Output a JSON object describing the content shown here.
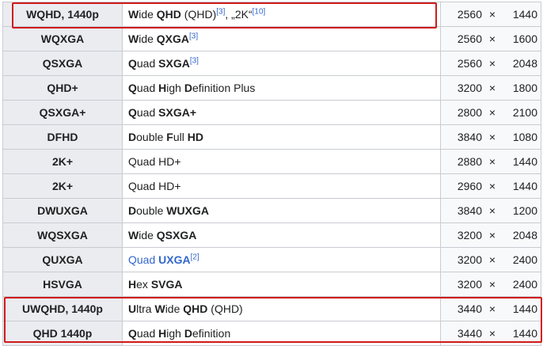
{
  "rows": [
    {
      "name": "WQHD, 1440p",
      "desc": [
        [
          "W",
          true
        ],
        [
          "ide ",
          false
        ],
        [
          "QHD",
          true
        ],
        [
          " (QHD)",
          false
        ]
      ],
      "sup1": "[3]",
      "extra": ", „2K“",
      "sup2": "[10]",
      "w": "2560",
      "h": "1440"
    },
    {
      "name": "WQXGA",
      "desc": [
        [
          "W",
          true
        ],
        [
          "ide ",
          false
        ],
        [
          "QXGA",
          true
        ]
      ],
      "sup1": "[3]",
      "w": "2560",
      "h": "1600"
    },
    {
      "name": "QSXGA",
      "desc": [
        [
          "Q",
          true
        ],
        [
          "uad ",
          false
        ],
        [
          "SXGA",
          true
        ]
      ],
      "sup1": "[3]",
      "w": "2560",
      "h": "2048"
    },
    {
      "name": "QHD+",
      "desc": [
        [
          "Q",
          true
        ],
        [
          "uad ",
          false
        ],
        [
          "H",
          true
        ],
        [
          "igh ",
          false
        ],
        [
          "D",
          true
        ],
        [
          "efinition Plus",
          false
        ]
      ],
      "w": "3200",
      "h": "1800"
    },
    {
      "name": "QSXGA+",
      "desc": [
        [
          "Q",
          true
        ],
        [
          "uad ",
          false
        ],
        [
          "SXGA+",
          true
        ]
      ],
      "w": "2800",
      "h": "2100"
    },
    {
      "name": "DFHD",
      "desc": [
        [
          "D",
          true
        ],
        [
          "ouble ",
          false
        ],
        [
          "F",
          true
        ],
        [
          "ull ",
          false
        ],
        [
          "HD",
          true
        ]
      ],
      "w": "3840",
      "h": "1080"
    },
    {
      "name": "2K+",
      "desc": [
        [
          "Quad HD+",
          false
        ]
      ],
      "w": "2880",
      "h": "1440"
    },
    {
      "name": "2K+",
      "desc": [
        [
          "Quad HD+",
          false
        ]
      ],
      "w": "2960",
      "h": "1440"
    },
    {
      "name": "DWUXGA",
      "desc": [
        [
          "D",
          true
        ],
        [
          "ouble ",
          false
        ],
        [
          "WUXGA",
          true
        ]
      ],
      "w": "3840",
      "h": "1200"
    },
    {
      "name": "WQSXGA",
      "desc": [
        [
          "W",
          true
        ],
        [
          "ide ",
          false
        ],
        [
          "QSXGA",
          true
        ]
      ],
      "w": "3200",
      "h": "2048"
    },
    {
      "name": "QUXGA",
      "link": true,
      "desc": [
        [
          "Quad ",
          false
        ],
        [
          "UXGA",
          true
        ]
      ],
      "sup1": "[2]",
      "w": "3200",
      "h": "2400"
    },
    {
      "name": "HSVGA",
      "desc": [
        [
          "H",
          true
        ],
        [
          "ex ",
          false
        ],
        [
          "SVGA",
          true
        ]
      ],
      "w": "3200",
      "h": "2400"
    },
    {
      "name": "UWQHD, 1440p",
      "desc": [
        [
          "U",
          true
        ],
        [
          "ltra ",
          false
        ],
        [
          "W",
          true
        ],
        [
          "ide ",
          false
        ],
        [
          "QHD",
          true
        ],
        [
          " (QHD)",
          false
        ]
      ],
      "w": "3440",
      "h": "1440"
    },
    {
      "name": "QHD 1440p",
      "desc": [
        [
          "Q",
          true
        ],
        [
          "uad ",
          false
        ],
        [
          "H",
          true
        ],
        [
          "igh ",
          false
        ],
        [
          "D",
          true
        ],
        [
          "efinition",
          false
        ]
      ],
      "w": "3440",
      "h": "1440"
    }
  ],
  "times_sign": "×",
  "highlight_color": "#d11a1a"
}
